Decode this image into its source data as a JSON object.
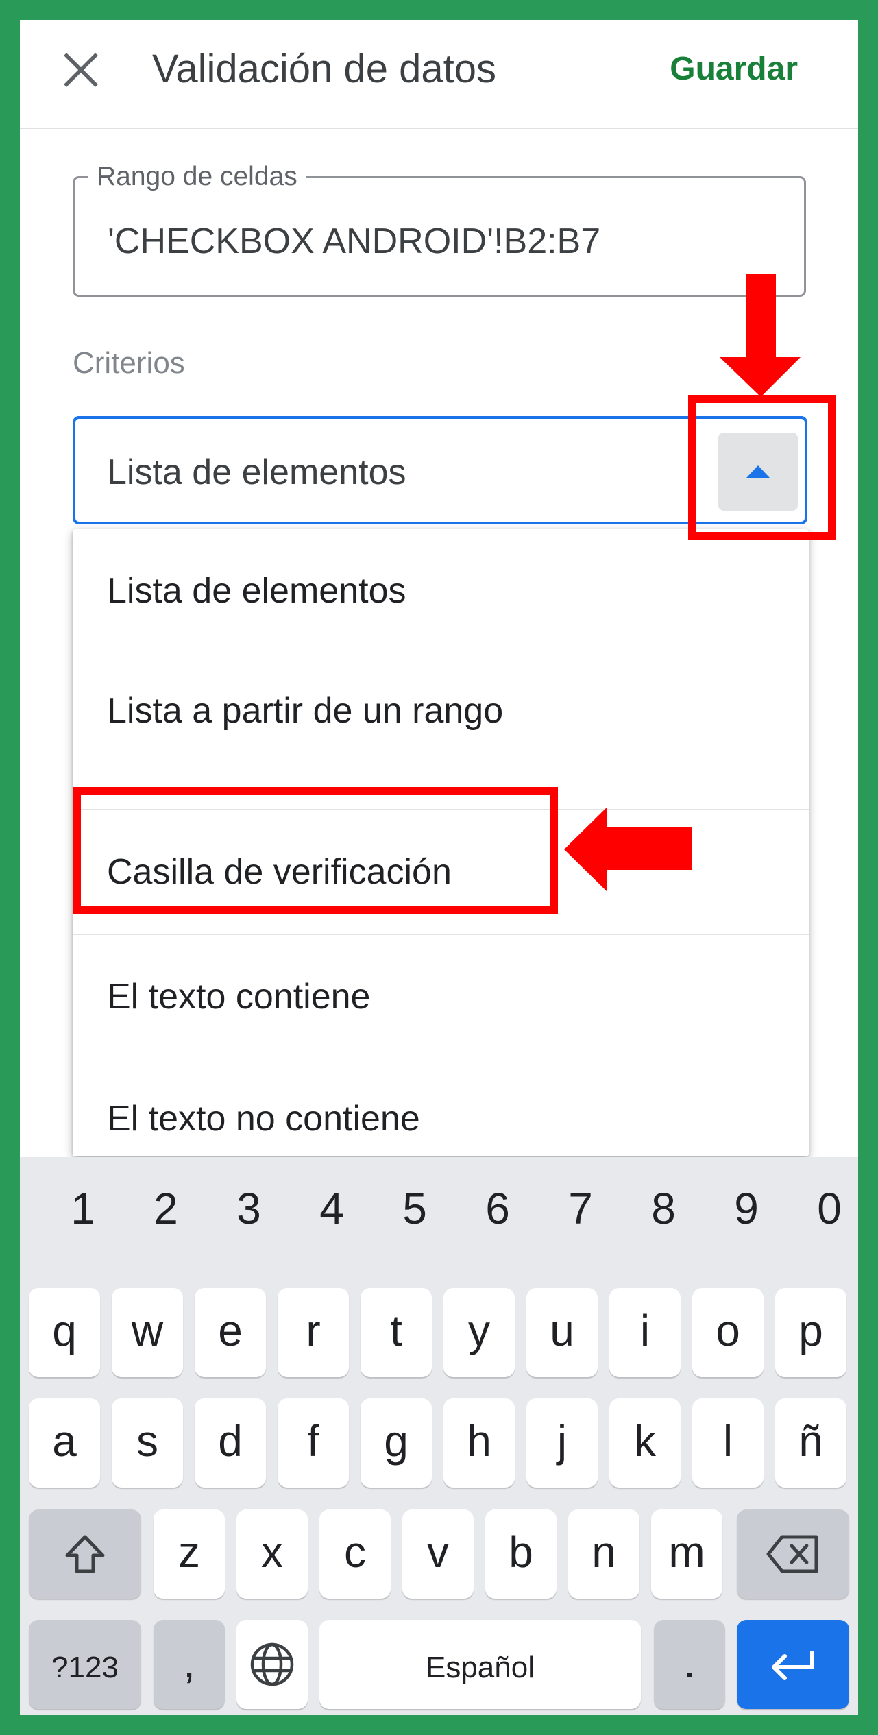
{
  "header": {
    "close_icon": "close-icon",
    "title": "Validación de datos",
    "save_label": "Guardar"
  },
  "range": {
    "label": "Rango de celdas",
    "value": "'CHECKBOX ANDROID'!B2:B7"
  },
  "criteria": {
    "section_label": "Criterios",
    "selected": "Lista de elementos",
    "toggle_icon": "caret-up-icon",
    "options": [
      "Lista de elementos",
      "Lista a partir de un rango",
      "Casilla de verificación",
      "El texto contiene",
      "El texto no contiene"
    ]
  },
  "keyboard": {
    "numbers": [
      "1",
      "2",
      "3",
      "4",
      "5",
      "6",
      "7",
      "8",
      "9",
      "0"
    ],
    "row1": [
      "q",
      "w",
      "e",
      "r",
      "t",
      "y",
      "u",
      "i",
      "o",
      "p"
    ],
    "row2": [
      "a",
      "s",
      "d",
      "f",
      "g",
      "h",
      "j",
      "k",
      "l",
      "ñ"
    ],
    "row3": [
      "z",
      "x",
      "c",
      "v",
      "b",
      "n",
      "m"
    ],
    "symbols_label": "?123",
    "comma": ",",
    "space_label": "Español",
    "period": ".",
    "icons": [
      "shift-icon",
      "backspace-icon",
      "globe-icon",
      "enter-icon"
    ]
  },
  "colors": {
    "frame": "#2a9a59",
    "accent": "#1a73e8",
    "save": "#188038",
    "annotation": "#ff0000"
  }
}
